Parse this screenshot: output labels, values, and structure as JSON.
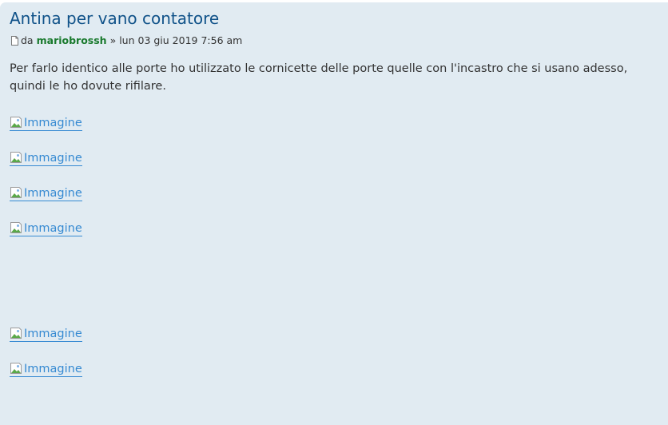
{
  "post": {
    "title": "Antina per vano contatore",
    "meta": {
      "by_prefix": "da",
      "author": "mariobrossh",
      "separator_and_date": "» lun 03 giu 2019 7:56 am"
    },
    "body_text": "Per farlo identico alle porte ho utilizzato le cornicette delle porte quelle con l'incastro che si usano adesso, quindi le ho dovute rifilare.",
    "images": [
      {
        "alt": "Immagine"
      },
      {
        "alt": "Immagine"
      },
      {
        "alt": "Immagine"
      },
      {
        "alt": "Immagine"
      },
      {
        "alt": "Immagine"
      },
      {
        "alt": "Immagine"
      }
    ]
  },
  "colors": {
    "post_background": "#e1ebf2",
    "title": "#105289",
    "author": "#1a7a2e",
    "link": "#368ad2",
    "text": "#333333"
  },
  "icons": {
    "post_icon": "page-icon",
    "broken_image_icon": "broken-image-icon"
  }
}
